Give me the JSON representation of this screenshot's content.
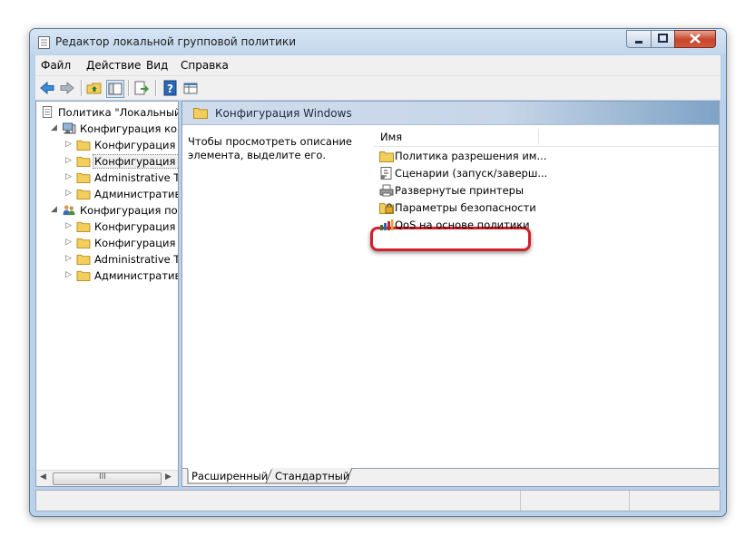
{
  "window": {
    "title": "Редактор локальной групповой политики"
  },
  "menu": {
    "items": [
      {
        "label": "Файл"
      },
      {
        "label": "Действие"
      },
      {
        "label": "Вид"
      },
      {
        "label": "Справка"
      }
    ]
  },
  "tree": {
    "items": [
      {
        "label": "Политика \"Локальный",
        "icon": "policy-doc-icon",
        "level": 0,
        "expander": ""
      },
      {
        "label": "Конфигурация комп",
        "icon": "computer-icon",
        "level": 1,
        "expander": "◢"
      },
      {
        "label": "Конфигурация п",
        "icon": "folder-icon",
        "level": 2,
        "expander": "▷"
      },
      {
        "label": "Конфигурация W",
        "icon": "folder-icon",
        "level": 2,
        "expander": "▷",
        "selected": true
      },
      {
        "label": "Administrative Te",
        "icon": "folder-icon",
        "level": 2,
        "expander": "▷"
      },
      {
        "label": "Административ",
        "icon": "folder-icon",
        "level": 2,
        "expander": "▷"
      },
      {
        "label": "Конфигурация поль",
        "icon": "users-icon",
        "level": 1,
        "expander": "◢"
      },
      {
        "label": "Конфигурация п",
        "icon": "folder-icon",
        "level": 2,
        "expander": "▷"
      },
      {
        "label": "Конфигурация W",
        "icon": "folder-icon",
        "level": 2,
        "expander": "▷"
      },
      {
        "label": "Administrative Te",
        "icon": "folder-icon",
        "level": 2,
        "expander": "▷"
      },
      {
        "label": "Административ",
        "icon": "folder-icon",
        "level": 2,
        "expander": "▷"
      }
    ],
    "scroll_thumb": "III"
  },
  "details": {
    "header": "Конфигурация Windows",
    "description": "Чтобы просмотреть описание элемента, выделите его.",
    "column_name": "Имя",
    "items": [
      {
        "label": "Политика разрешения им...",
        "icon": "folder-icon"
      },
      {
        "label": "Сценарии (запуск/заверш...",
        "icon": "script-icon"
      },
      {
        "label": "Развернутые принтеры",
        "icon": "printer-icon"
      },
      {
        "label": "Параметры безопасности",
        "icon": "security-settings-icon",
        "highlighted": true
      },
      {
        "label": "QoS на основе политики",
        "icon": "qos-icon"
      }
    ]
  },
  "tabs": [
    {
      "label": "Расширенный",
      "active": true
    },
    {
      "label": "Стандартный",
      "active": false
    }
  ],
  "colors": {
    "highlight": "#d3212b",
    "folder": "#f2cf5c",
    "window_frame": "#b9d1ea"
  }
}
